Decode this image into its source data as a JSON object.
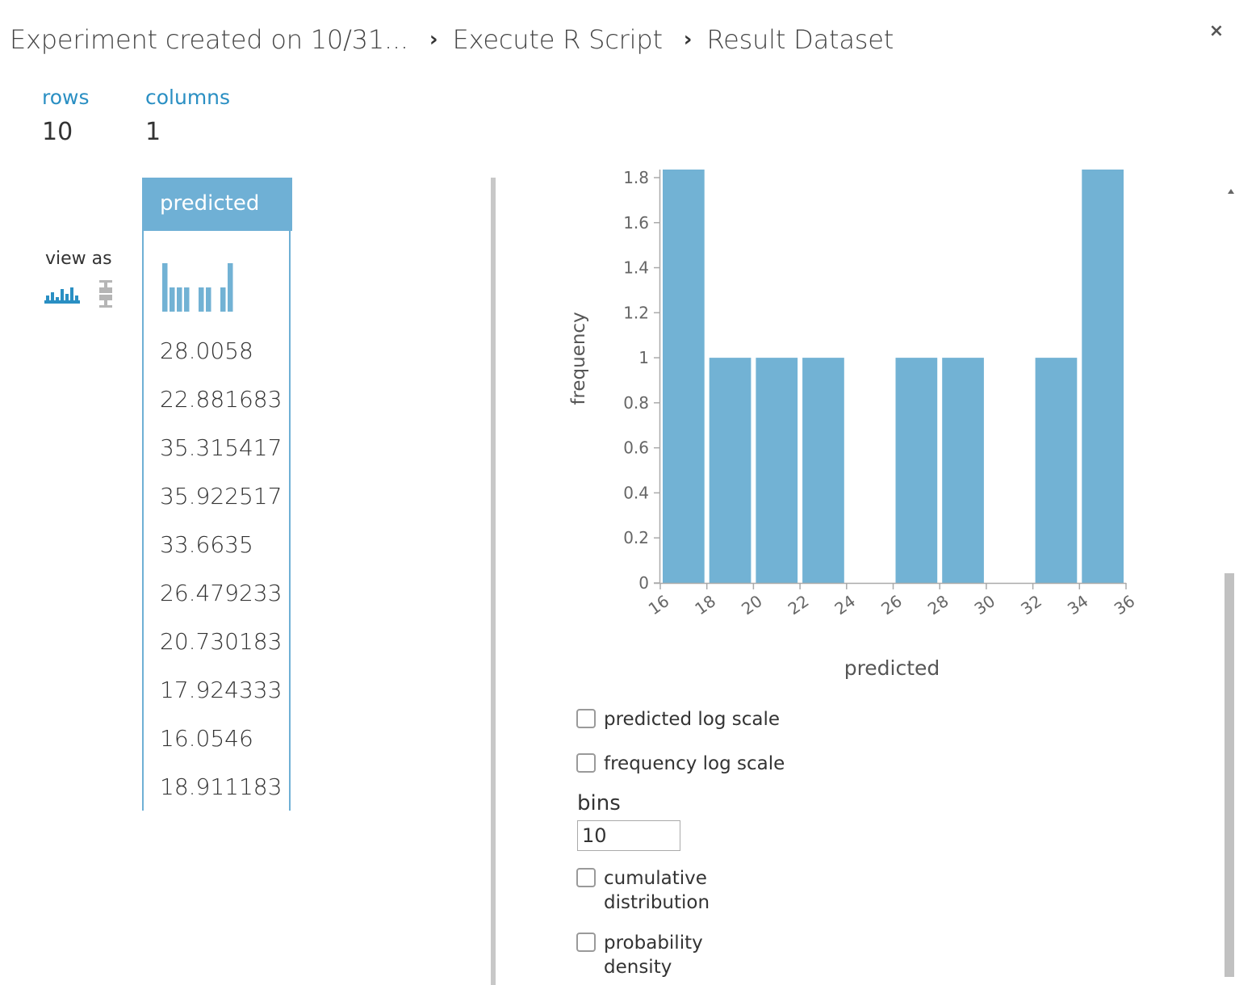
{
  "breadcrumb": {
    "experiment": "Experiment created on 10/31...",
    "module": "Execute R Script",
    "output": "Result Dataset",
    "separator": "›"
  },
  "close_label": "×",
  "stats": {
    "rows_label": "rows",
    "rows_value": "10",
    "columns_label": "columns",
    "columns_value": "1"
  },
  "view_as": {
    "label": "view as",
    "icons": [
      "histogram-icon",
      "boxplot-icon"
    ]
  },
  "column": {
    "header": "predicted",
    "values": [
      "28.0058",
      "22.881683",
      "35.315417",
      "35.922517",
      "33.6635",
      "26.479233",
      "20.730183",
      "17.924333",
      "16.0546",
      "18.911183"
    ]
  },
  "chart_data": {
    "type": "bar",
    "xlabel": "predicted",
    "ylabel": "frequency",
    "x_ticks": [
      "16",
      "18",
      "20",
      "22",
      "24",
      "26",
      "28",
      "30",
      "32",
      "34",
      "36"
    ],
    "y_ticks": [
      "0",
      "0.2",
      "0.4",
      "0.6",
      "0.8",
      "1",
      "1.2",
      "1.4",
      "1.6",
      "1.8"
    ],
    "bins": [
      {
        "from": 16,
        "to": 18,
        "value": 2
      },
      {
        "from": 18,
        "to": 20,
        "value": 1
      },
      {
        "from": 20,
        "to": 22,
        "value": 1
      },
      {
        "from": 22,
        "to": 24,
        "value": 1
      },
      {
        "from": 24,
        "to": 26,
        "value": 0
      },
      {
        "from": 26,
        "to": 28,
        "value": 1
      },
      {
        "from": 28,
        "to": 30,
        "value": 1
      },
      {
        "from": 30,
        "to": 32,
        "value": 0
      },
      {
        "from": 32,
        "to": 34,
        "value": 1
      },
      {
        "from": 34,
        "to": 36,
        "value": 2
      }
    ],
    "xlim": [
      16,
      36
    ],
    "ylim": [
      0,
      1.8
    ],
    "bar_color": "#72b2d4",
    "grid": false,
    "legend": "none"
  },
  "options": {
    "predicted_log_scale": {
      "label": "predicted log scale",
      "checked": false
    },
    "frequency_log_scale": {
      "label": "frequency log scale",
      "checked": false
    },
    "bins_label": "bins",
    "bins_value": "10",
    "cumulative_line1": "cumulative",
    "cumulative_line2": "distribution",
    "probability_line1": "probability",
    "probability_line2": "density"
  },
  "colors": {
    "accent": "#2a8fc3",
    "column_header": "#6fb0d5",
    "bar": "#72b2d4"
  }
}
